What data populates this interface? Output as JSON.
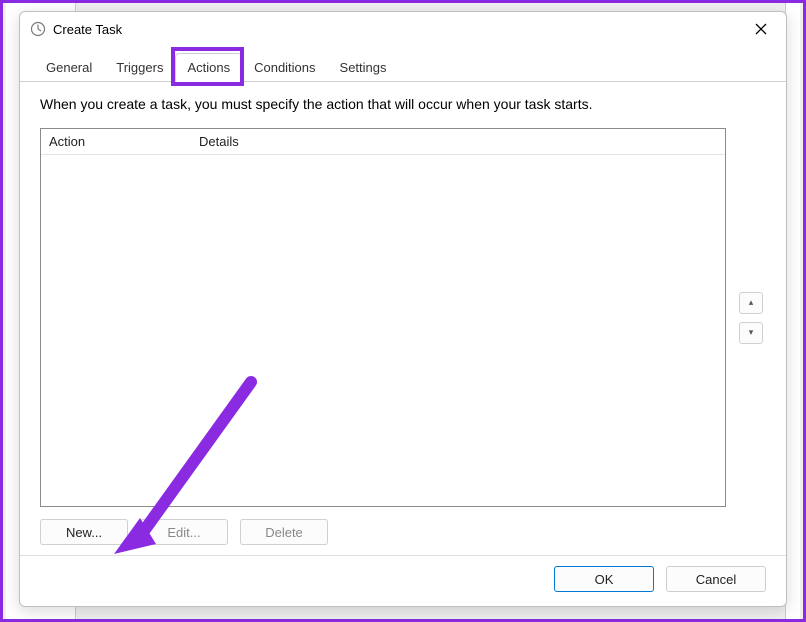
{
  "window": {
    "title": "Create Task"
  },
  "tabs": {
    "general": "General",
    "triggers": "Triggers",
    "actions": "Actions",
    "conditions": "Conditions",
    "settings": "Settings",
    "active": "actions"
  },
  "content": {
    "description": "When you create a task, you must specify the action that will occur when your task starts."
  },
  "listview": {
    "col_action": "Action",
    "col_details": "Details"
  },
  "buttons": {
    "new": "New...",
    "edit": "Edit...",
    "delete": "Delete",
    "ok": "OK",
    "cancel": "Cancel",
    "move_up": "▴",
    "move_down": "▾"
  },
  "annotation": {
    "highlight_tab": "actions",
    "arrow_target": "new-button",
    "color": "#8a2be2"
  }
}
